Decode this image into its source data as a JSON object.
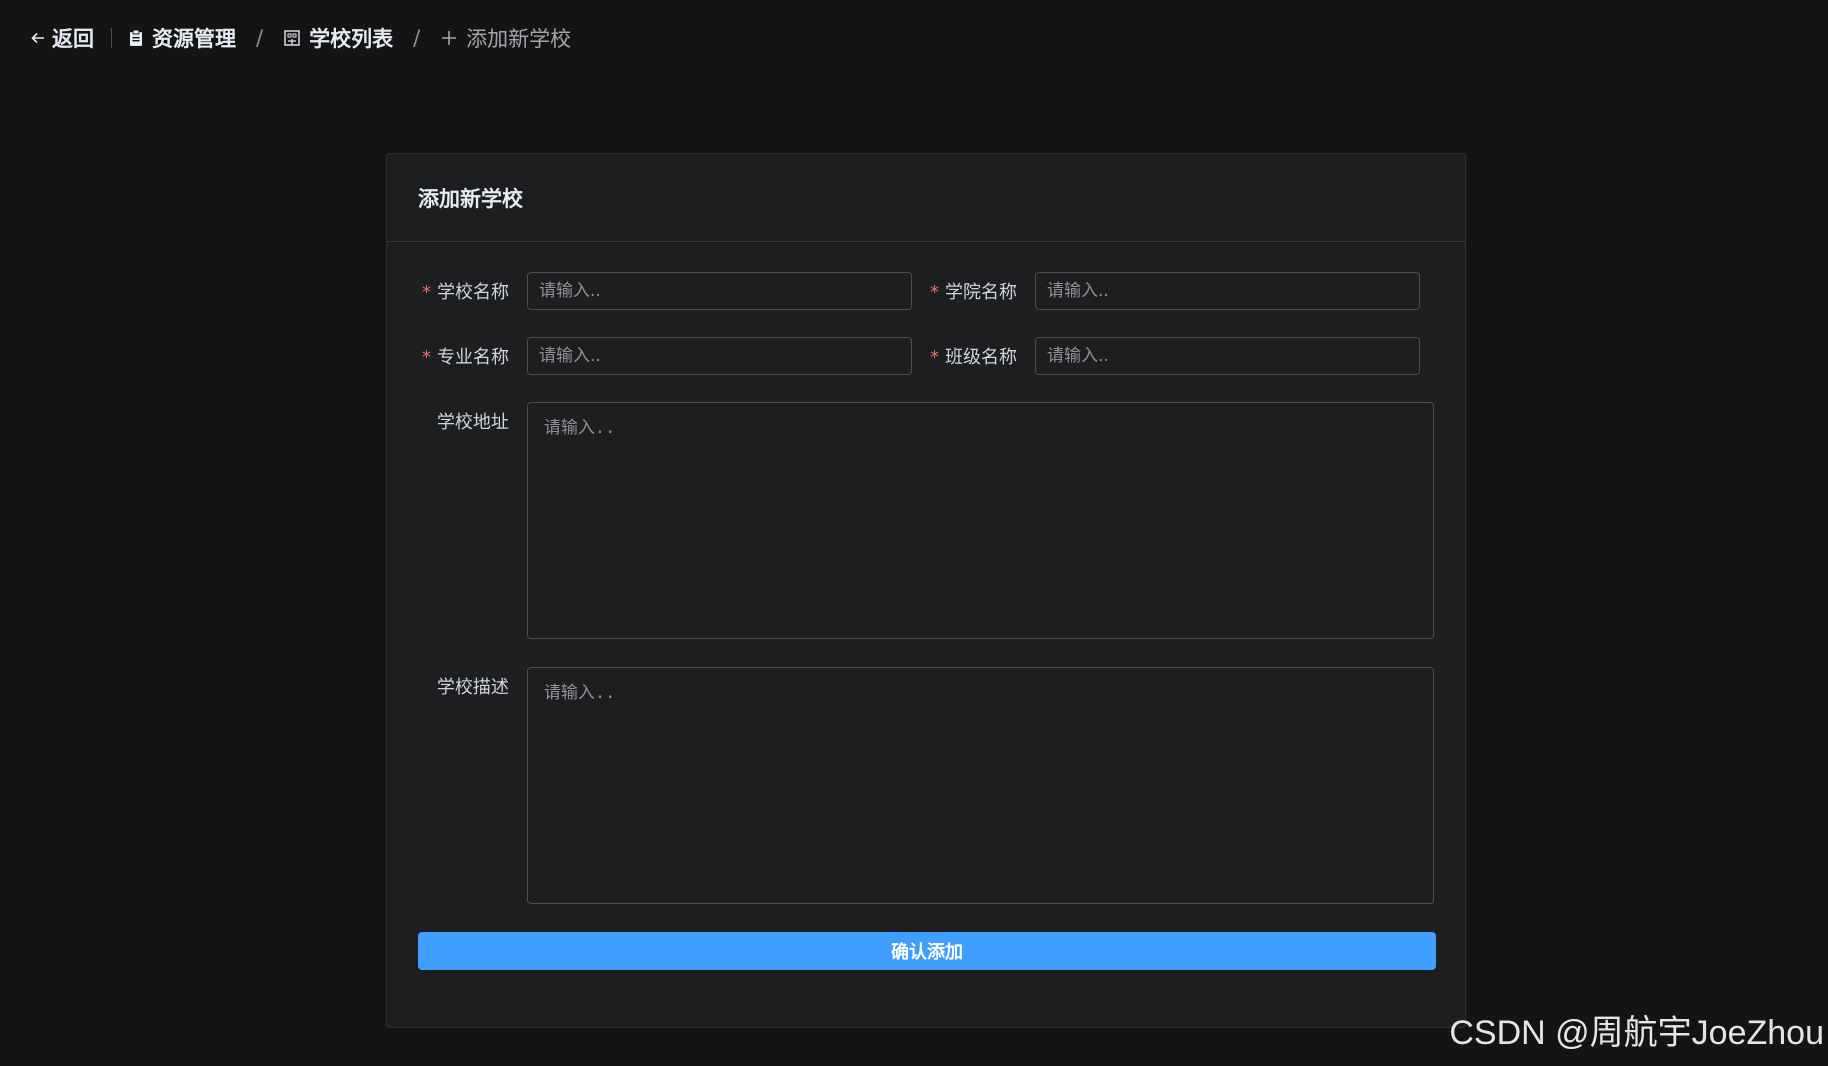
{
  "header": {
    "back_label": "返回",
    "breadcrumb": [
      {
        "label": "资源管理",
        "icon": "clipboard-icon"
      },
      {
        "label": "学校列表",
        "icon": "building-icon"
      },
      {
        "label": "添加新学校",
        "icon": "plus-icon"
      }
    ],
    "separator": "/"
  },
  "card": {
    "title": "添加新学校",
    "required_mark": "*",
    "fields": {
      "school_name": {
        "label": "学校名称",
        "placeholder": "请输入..",
        "required": true
      },
      "college_name": {
        "label": "学院名称",
        "placeholder": "请输入..",
        "required": true
      },
      "major_name": {
        "label": "专业名称",
        "placeholder": "请输入..",
        "required": true
      },
      "class_name": {
        "label": "班级名称",
        "placeholder": "请输入..",
        "required": true
      },
      "address": {
        "label": "学校地址",
        "placeholder": "请输入..",
        "required": false
      },
      "description": {
        "label": "学校描述",
        "placeholder": "请输入..",
        "required": false
      }
    },
    "submit_label": "确认添加"
  },
  "watermark": "CSDN @周航宇JoeZhou",
  "colors": {
    "background": "#141414",
    "card": "#1d1e1f",
    "primary": "#409eff",
    "required": "#f56c6c",
    "border": "#4c4d4f"
  }
}
